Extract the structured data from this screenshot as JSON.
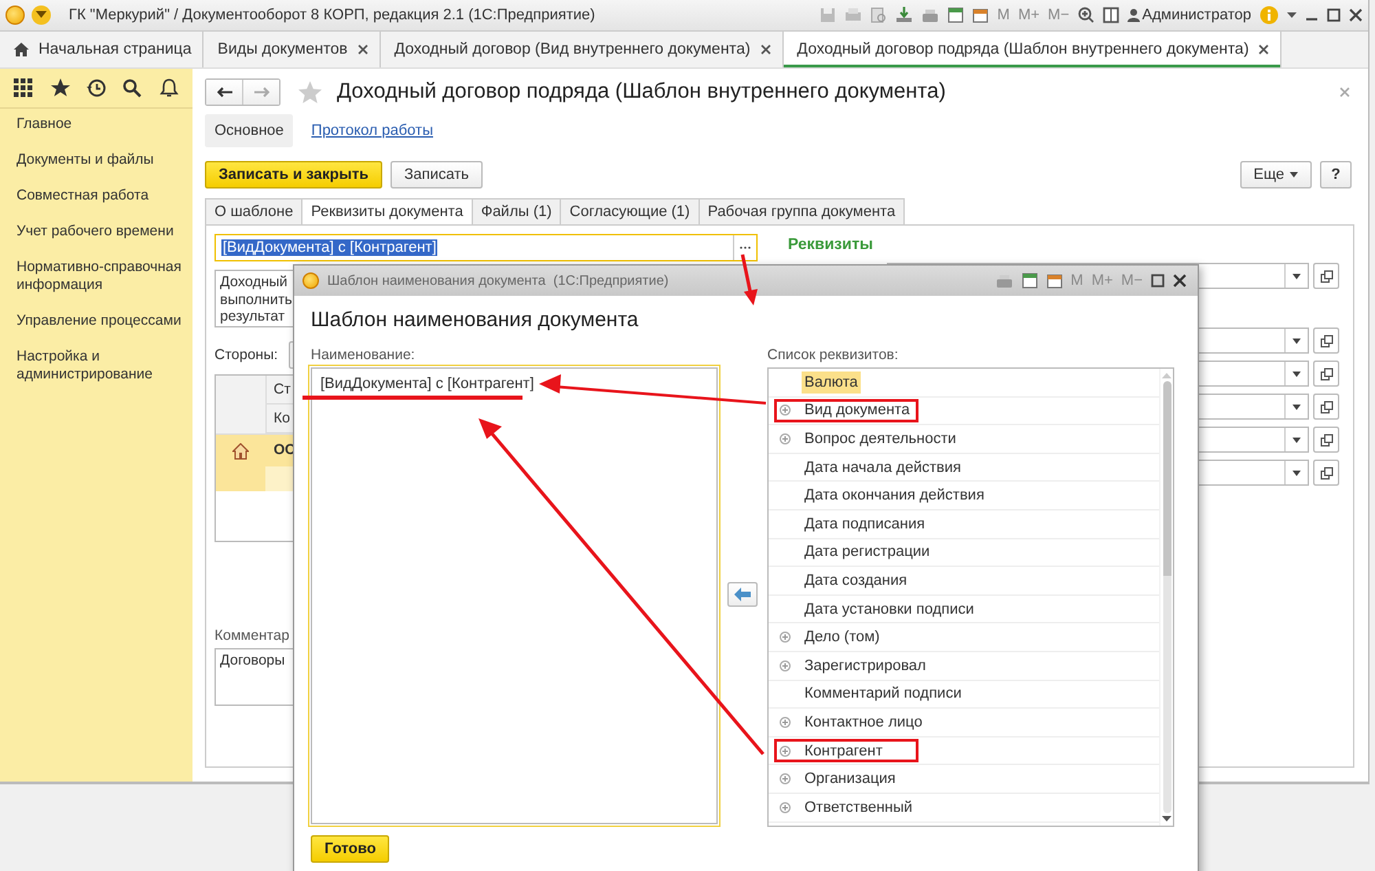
{
  "window": {
    "title": "ГК \"Меркурий\" / Документооборот 8 КОРП, редакция 2.1  (1С:Предприятие)",
    "calc_keys": [
      "M",
      "M+",
      "M−"
    ],
    "user": "Администратор"
  },
  "tabs": [
    {
      "label": "Начальная страница",
      "kind": "home",
      "selected": false
    },
    {
      "label": "Виды документов",
      "kind": "closable",
      "selected": false
    },
    {
      "label": "Доходный договор (Вид внутреннего документа)",
      "kind": "closable",
      "selected": false
    },
    {
      "label": "Доходный договор подряда (Шаблон внутреннего документа)",
      "kind": "closable",
      "selected": true
    }
  ],
  "sidebar": {
    "items": [
      "Главное",
      "Документы и файлы",
      "Совместная работа",
      "Учет рабочего времени",
      "Нормативно-справочная информация",
      "Управление процессами",
      "Настройка и администрирование"
    ]
  },
  "form": {
    "title": "Доходный договор подряда (Шаблон внутреннего документа)",
    "sections": [
      {
        "label": "Основное",
        "selected": true
      },
      {
        "label": "Протокол работы",
        "selected": false
      }
    ],
    "buttons": [
      {
        "label": "Записать и закрыть",
        "kind": "primary"
      },
      {
        "label": "Записать",
        "kind": "normal"
      }
    ],
    "more_button": "Еще",
    "help_button": "?",
    "tabs": [
      {
        "label": "О шаблоне",
        "selected": false
      },
      {
        "label": "Реквизиты документа",
        "selected": true
      },
      {
        "label": "Файлы (1)",
        "selected": false
      },
      {
        "label": "Согласующие (1)",
        "selected": false
      },
      {
        "label": "Рабочая группа документа",
        "selected": false
      }
    ],
    "name_field": {
      "value": "[ВидДокумента] с [Контрагент]",
      "text_selected": true
    },
    "description_lines": [
      "Доходный",
      "выполнить",
      "результат"
    ],
    "parties_label": "Стороны:",
    "parties_table": {
      "columns": [
        "Ст",
        "Ко"
      ],
      "rows": [
        {
          "cell": "ОС"
        }
      ]
    },
    "comment_label": "Комментар",
    "comment": "Договоры",
    "details_heading": "Реквизиты"
  },
  "dialog": {
    "title": "Шаблон наименования документа  (1С:Предприятие)",
    "calc_keys": [
      "M",
      "M+",
      "M−"
    ],
    "heading": "Шаблон наименования документа",
    "name_label": "Наименование:",
    "name_value": "[ВидДокумента] с [Контрагент]",
    "list_label": "Список реквизитов:",
    "attributes": [
      {
        "label": "Валюта",
        "expandable": false,
        "selected": true,
        "marked": false
      },
      {
        "label": "Вид документа",
        "expandable": true,
        "selected": false,
        "marked": true
      },
      {
        "label": "Вопрос деятельности",
        "expandable": true,
        "selected": false,
        "marked": false
      },
      {
        "label": "Дата начала действия",
        "expandable": false,
        "selected": false,
        "marked": false
      },
      {
        "label": "Дата окончания действия",
        "expandable": false,
        "selected": false,
        "marked": false
      },
      {
        "label": "Дата подписания",
        "expandable": false,
        "selected": false,
        "marked": false
      },
      {
        "label": "Дата регистрации",
        "expandable": false,
        "selected": false,
        "marked": false
      },
      {
        "label": "Дата создания",
        "expandable": false,
        "selected": false,
        "marked": false
      },
      {
        "label": "Дата установки подписи",
        "expandable": false,
        "selected": false,
        "marked": false
      },
      {
        "label": "Дело (том)",
        "expandable": true,
        "selected": false,
        "marked": false
      },
      {
        "label": "Зарегистрировал",
        "expandable": true,
        "selected": false,
        "marked": false
      },
      {
        "label": "Комментарий подписи",
        "expandable": false,
        "selected": false,
        "marked": false
      },
      {
        "label": "Контактное лицо",
        "expandable": true,
        "selected": false,
        "marked": false
      },
      {
        "label": "Контрагент",
        "expandable": true,
        "selected": false,
        "marked": true
      },
      {
        "label": "Организация",
        "expandable": true,
        "selected": false,
        "marked": false
      },
      {
        "label": "Ответственный",
        "expandable": true,
        "selected": false,
        "marked": false
      }
    ],
    "done_button": "Готово"
  }
}
